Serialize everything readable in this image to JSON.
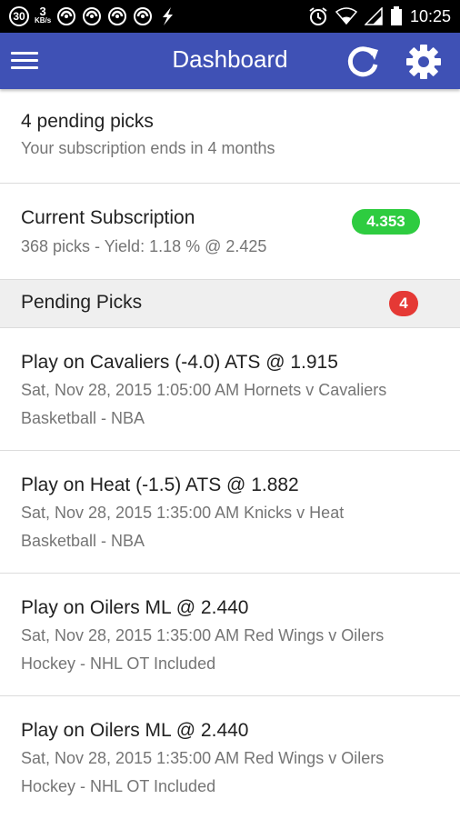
{
  "status_bar": {
    "notif_count": "30",
    "speed_value": "3",
    "speed_unit": "KB/s",
    "time": "10:25",
    "icons": [
      "swirl-icon",
      "swirl-icon",
      "swirl-icon",
      "swirl-icon",
      "lightning-icon",
      "alarm-icon",
      "wifi-icon",
      "signal-icon",
      "battery-icon"
    ]
  },
  "app_bar": {
    "title": "Dashboard",
    "menu_icon": "hamburger-menu-icon",
    "refresh_icon": "refresh-icon",
    "settings_icon": "gear-icon",
    "color": "#3f51b5"
  },
  "summary": {
    "title": "4 pending picks",
    "subtitle": "Your subscription ends in 4 months"
  },
  "subscription": {
    "title": "Current Subscription",
    "details": "368 picks - Yield: 1.18 % @ 2.425",
    "badge": "4.353",
    "badge_color": "#2ecc40"
  },
  "pending_section": {
    "title": "Pending Picks",
    "count": "4",
    "count_color": "#e53935"
  },
  "picks": [
    {
      "title": "Play on Cavaliers (-4.0) ATS @ 1.915",
      "datetime": "Sat, Nov 28, 2015 1:05:00 AM Hornets v Cavaliers",
      "league": "Basketball - NBA"
    },
    {
      "title": "Play on Heat (-1.5) ATS @ 1.882",
      "datetime": "Sat, Nov 28, 2015 1:35:00 AM Knicks v Heat",
      "league": "Basketball - NBA"
    },
    {
      "title": "Play on Oilers ML @ 2.440",
      "datetime": "Sat, Nov 28, 2015 1:35:00 AM Red Wings v Oilers",
      "league": "Hockey - NHL OT Included"
    },
    {
      "title": "Play on Oilers ML @ 2.440",
      "datetime": "Sat, Nov 28, 2015 1:35:00 AM Red Wings v Oilers",
      "league": "Hockey - NHL OT Included"
    }
  ]
}
